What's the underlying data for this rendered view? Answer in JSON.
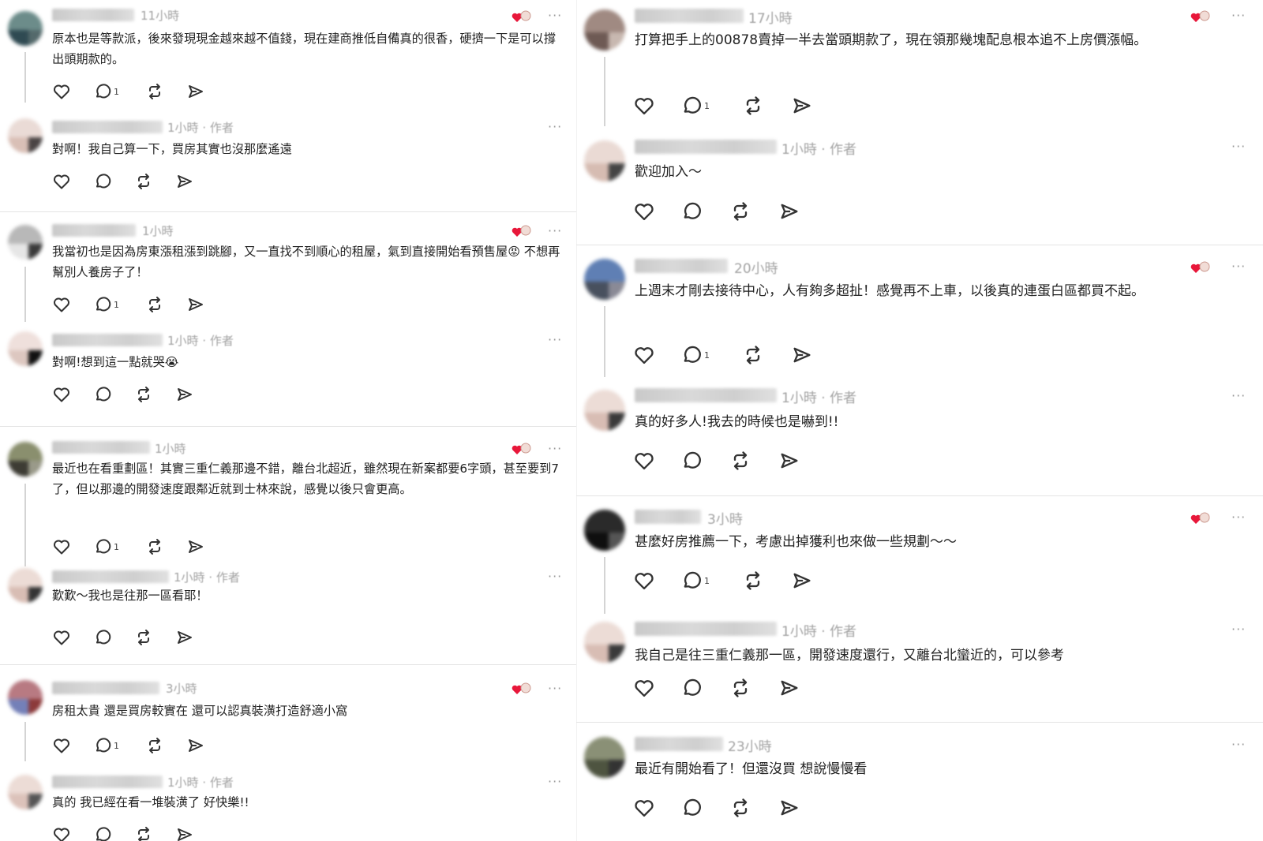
{
  "ui": {
    "more_label": "···",
    "author_tag": "作者",
    "meta_sep": " · "
  },
  "left_column": [
    {
      "comment": {
        "time": "11小時",
        "text": "原本也是等款派，後來發現現金越來越不值錢，現在建商推低自備真的很香，硬擠一下是可以撐出頭期款的。",
        "reply_count": "1",
        "liked_by_author": true
      },
      "reply": {
        "time": "1小時",
        "text": "對啊！我自己算一下，買房其實也沒那麼遙遠"
      }
    },
    {
      "comment": {
        "time": "1小時",
        "text": "我當初也是因為房東漲租漲到跳腳，又一直找不到順心的租屋，氣到直接開始看預售屋😡 不想再幫別人養房子了！",
        "reply_count": "1",
        "liked_by_author": true
      },
      "reply": {
        "time": "1小時",
        "text": "對啊!想到這一點就哭😭"
      }
    },
    {
      "comment": {
        "time": "1小時",
        "text": "最近也在看重劃區！其實三重仁義那邊不錯，離台北超近，雖然現在新案都要6字頭，甚至要到7了，但以那邊的開發速度跟鄰近就到士林來說，感覺以後只會更高。",
        "reply_count": "1",
        "liked_by_author": true
      },
      "reply": {
        "time": "1小時",
        "text": "歎歎～我也是往那一區看耶！"
      }
    },
    {
      "comment": {
        "time": "3小時",
        "text": "房租太貴 還是買房較實在 還可以認真裝潢打造舒適小窩",
        "reply_count": "1",
        "liked_by_author": true
      },
      "reply": {
        "time": "1小時",
        "text": "真的 我已經在看一堆裝潢了 好快樂!!"
      }
    }
  ],
  "right_column": [
    {
      "comment": {
        "time": "17小時",
        "text": "打算把手上的00878賣掉一半去當頭期款了，現在領那幾塊配息根本追不上房價漲幅。",
        "reply_count": "1",
        "liked_by_author": true
      },
      "reply": {
        "time": "1小時",
        "text": "歡迎加入～"
      }
    },
    {
      "comment": {
        "time": "20小時",
        "text": "上週末才剛去接待中心，人有夠多超扯！感覺再不上車，以後真的連蛋白區都買不起。",
        "reply_count": "1",
        "liked_by_author": true
      },
      "reply": {
        "time": "1小時",
        "text": "真的好多人!我去的時候也是嚇到!!"
      }
    },
    {
      "comment": {
        "time": "3小時",
        "text": "甚麼好房推薦一下，考慮出掉獲利也來做一些規劃～～",
        "reply_count": "1",
        "liked_by_author": true
      },
      "reply": {
        "time": "1小時",
        "text": "我自己是往三重仁義那一區，開發速度還行，又離台北蠻近的，可以參考"
      }
    },
    {
      "comment": {
        "time": "23小時",
        "text": "最近有開始看了！但還沒買 想說慢慢看",
        "reply_count": "",
        "liked_by_author": false
      }
    }
  ],
  "colors": {
    "heart_red": "#e8173a",
    "meta_gray": "#a3a3a3",
    "icon_dark": "#333333",
    "divider": "#e4e4e4",
    "thread_line": "#d4d4d4"
  },
  "icons": [
    "heart-icon",
    "comment-icon",
    "repost-icon",
    "share-icon",
    "more-icon",
    "author-liked-icon"
  ]
}
